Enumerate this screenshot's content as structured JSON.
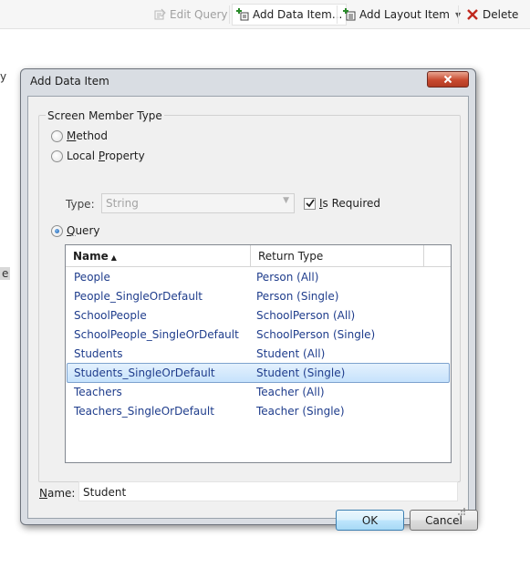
{
  "toolbar": {
    "edit_query": "Edit Query",
    "add_data_item": "Add Data Item...",
    "add_layout_item": "Add Layout Item",
    "delete": "Delete"
  },
  "background": {
    "fragment_y": "y",
    "fragment_e": "e"
  },
  "dialog": {
    "title": "Add Data Item",
    "group_title": "Screen Member Type",
    "options": {
      "method": {
        "hot": "M",
        "rest": "ethod"
      },
      "local_property": {
        "pre": "Local ",
        "hot": "P",
        "rest": "roperty"
      },
      "query": {
        "hot": "Q",
        "rest": "uery"
      }
    },
    "selected_option": "query",
    "type_label": "Type:",
    "type_value": "String",
    "is_required": {
      "hot": "I",
      "rest": "s Required",
      "checked": true
    },
    "list": {
      "columns": {
        "name": "Name",
        "return_type": "Return Type"
      },
      "sort": "name-ascending",
      "rows": [
        {
          "name": "People",
          "ret": "Person (All)"
        },
        {
          "name": "People_SingleOrDefault",
          "ret": "Person (Single)"
        },
        {
          "name": "SchoolPeople",
          "ret": "SchoolPerson (All)"
        },
        {
          "name": "SchoolPeople_SingleOrDefault",
          "ret": "SchoolPerson (Single)"
        },
        {
          "name": "Students",
          "ret": "Student (All)"
        },
        {
          "name": "Students_SingleOrDefault",
          "ret": "Student (Single)"
        },
        {
          "name": "Teachers",
          "ret": "Teacher (All)"
        },
        {
          "name": "Teachers_SingleOrDefault",
          "ret": "Teacher (Single)"
        }
      ],
      "selected_index": 5
    },
    "name_field": {
      "hot": "N",
      "rest": "ame:",
      "value": "Student"
    },
    "ok_label": "OK",
    "cancel_label": "Cancel"
  },
  "colors": {
    "link_text": "#1f3d8c",
    "selection": "#c6e2fc",
    "close_button": "#c84a30",
    "delete_icon": "#c0281e"
  }
}
